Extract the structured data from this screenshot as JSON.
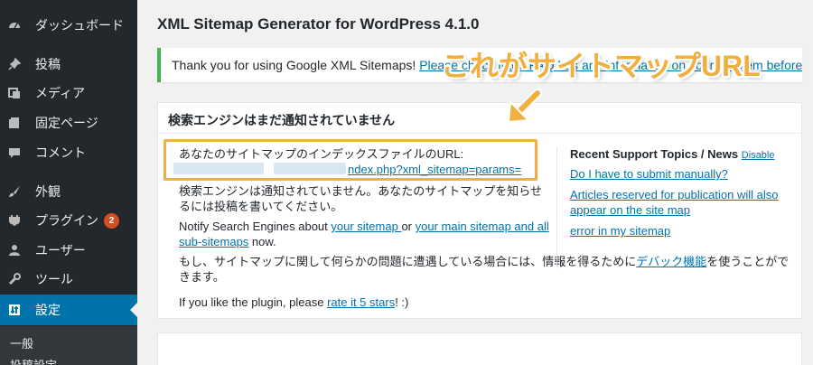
{
  "sidebar": {
    "items": [
      {
        "label": "ダッシュボード",
        "icon": "dashboard-icon"
      },
      {
        "label": "投稿",
        "icon": "pin-icon"
      },
      {
        "label": "メディア",
        "icon": "media-icon"
      },
      {
        "label": "固定ページ",
        "icon": "page-icon"
      },
      {
        "label": "コメント",
        "icon": "comment-icon"
      },
      {
        "label": "外観",
        "icon": "brush-icon"
      },
      {
        "label": "プラグイン",
        "icon": "plugin-icon",
        "badge": "2"
      },
      {
        "label": "ユーザー",
        "icon": "user-icon"
      },
      {
        "label": "ツール",
        "icon": "wrench-icon"
      },
      {
        "label": "設定",
        "icon": "settings-icon"
      }
    ],
    "submenu": [
      "一般",
      "投稿設定"
    ],
    "colors": {
      "bg": "#23282d",
      "active": "#0073aa",
      "badge": "#d54e21"
    }
  },
  "page": {
    "title": "XML Sitemap Generator for WordPress 4.1.0"
  },
  "notice": {
    "text": "Thank you for using Google XML Sitemaps! ",
    "link": "Please check if the FAQ has any information on your problem before asking for help or making a feature request."
  },
  "postbox": {
    "header": "検索エンジンはまだ通知されていません",
    "sitemap_label": "あなたのサイトマップのインデックスファイルのURL:",
    "sitemap_url": "ndex.php?xml_sitemap=params=",
    "not_notified": "検索エンジンは通知されていません。あなたのサイトマップを知らせるには投稿を書いてください。",
    "notify_prefix": "Notify Search Engines about ",
    "your_sitemap": "your sitemap ",
    "or": "or ",
    "main_sitemap": "your main sitemap and all sub-sitemaps",
    "now": " now.",
    "problem_prefix": "もし、サイトマップに関して何らかの問題に遭遇している場合には、情報を得るために",
    "debug_link": "デバック機能",
    "problem_suffix": "を使うことができます。",
    "rate_prefix": "If you like the plugin, please ",
    "rate_link": "rate it 5 stars",
    "rate_suffix": "! :)"
  },
  "support": {
    "title": "Recent Support Topics / News",
    "disable": "Disable",
    "links": [
      "Do I have to submit manually?",
      "Articles reserved for publication will also appear on the site map",
      "error in my sitemap"
    ]
  },
  "annotation": {
    "callout": "これがサイトマップURL",
    "color": "#f0b041"
  }
}
